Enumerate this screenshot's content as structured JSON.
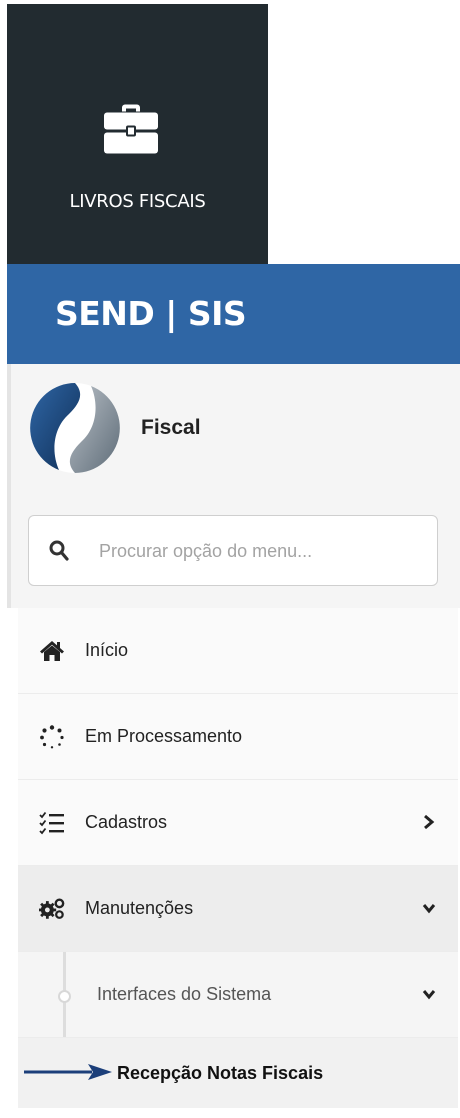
{
  "tile": {
    "label": "LIVROS FISCAIS",
    "icon": "briefcase-icon"
  },
  "header": {
    "brand": "SEND | SIS",
    "color": "#2f66a5"
  },
  "profile": {
    "module": "Fiscal",
    "logo_icon": "sendsis-logo"
  },
  "search": {
    "placeholder": "Procurar opção do menu...",
    "value": ""
  },
  "menu": {
    "items": [
      {
        "label": "Início",
        "icon": "home-icon"
      },
      {
        "label": "Em Processamento",
        "icon": "spinner-icon"
      },
      {
        "label": "Cadastros",
        "icon": "checklist-icon",
        "chevron": "chevron-right-icon"
      },
      {
        "label": "Manutenções",
        "icon": "gears-icon",
        "chevron": "chevron-down-icon",
        "expanded": true
      }
    ],
    "submenu": {
      "label": "Interfaces do Sistema",
      "chevron": "chevron-down-icon",
      "expanded": true
    },
    "leaf": {
      "label": "Recepção Notas Fiscais",
      "pointer": "arrow-right-icon"
    }
  }
}
